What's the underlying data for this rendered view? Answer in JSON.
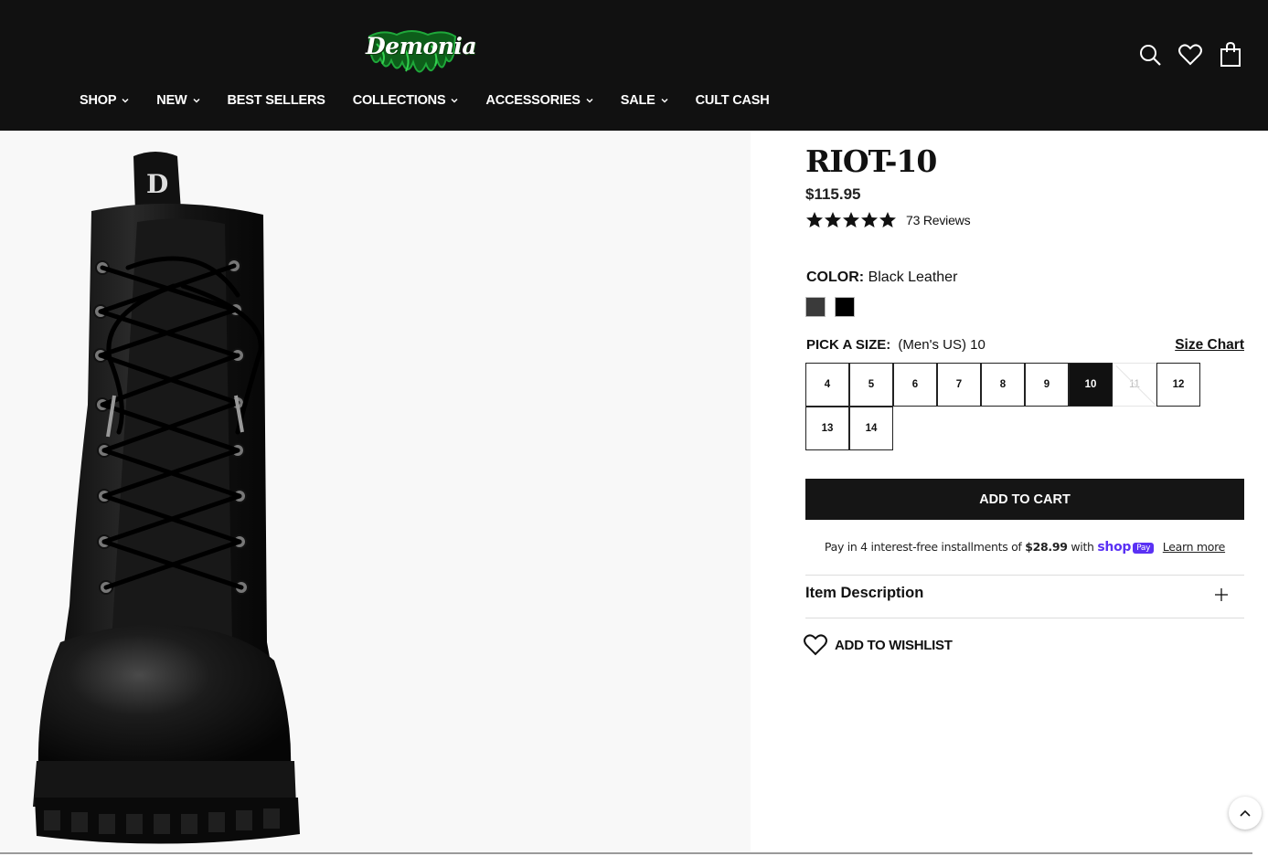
{
  "brand": {
    "logo_text": "Demonia"
  },
  "nav": {
    "items": [
      {
        "label": "SHOP",
        "has_dropdown": true
      },
      {
        "label": "NEW",
        "has_dropdown": true
      },
      {
        "label": "BEST SELLERS",
        "has_dropdown": false
      },
      {
        "label": "COLLECTIONS",
        "has_dropdown": true
      },
      {
        "label": "ACCESSORIES",
        "has_dropdown": true
      },
      {
        "label": "SALE",
        "has_dropdown": true
      },
      {
        "label": "CULT CASH",
        "has_dropdown": false
      }
    ]
  },
  "header_icons": [
    "search-icon",
    "heart-icon",
    "shopping-bag-icon"
  ],
  "product": {
    "title": "RIOT-10",
    "price": "$115.95",
    "rating": 4.5,
    "reviews_label": "73 Reviews",
    "color_label": "COLOR:",
    "color_value": "Black Leather",
    "swatches": [
      {
        "name": "swatch-dark-grey",
        "color": "#3a3a3a"
      },
      {
        "name": "swatch-black",
        "color": "#000000"
      }
    ],
    "size_label": "PICK A SIZE:",
    "size_value": "(Men's US) 10",
    "size_chart_label": "Size Chart",
    "sizes": [
      {
        "label": "4",
        "state": "available"
      },
      {
        "label": "5",
        "state": "available"
      },
      {
        "label": "6",
        "state": "available"
      },
      {
        "label": "7",
        "state": "available"
      },
      {
        "label": "8",
        "state": "available"
      },
      {
        "label": "9",
        "state": "available"
      },
      {
        "label": "10",
        "state": "selected"
      },
      {
        "label": "11",
        "state": "unavailable"
      },
      {
        "label": "12",
        "state": "available"
      },
      {
        "label": "13",
        "state": "available"
      },
      {
        "label": "14",
        "state": "available"
      }
    ],
    "add_to_cart_label": "ADD TO CART",
    "shoppay": {
      "prefix": "Pay in 4 interest-free installments of",
      "amount": "$28.99",
      "with": "with",
      "shop_text": "shop",
      "pay_badge": "Pay",
      "learn_more": "Learn more"
    },
    "item_description_label": "Item Description",
    "wishlist_label": "ADD TO WISHLIST"
  },
  "colors": {
    "header_bg": "#111111",
    "accent_green": "#1fa83a",
    "shoppay_purple": "#5a31f4"
  }
}
